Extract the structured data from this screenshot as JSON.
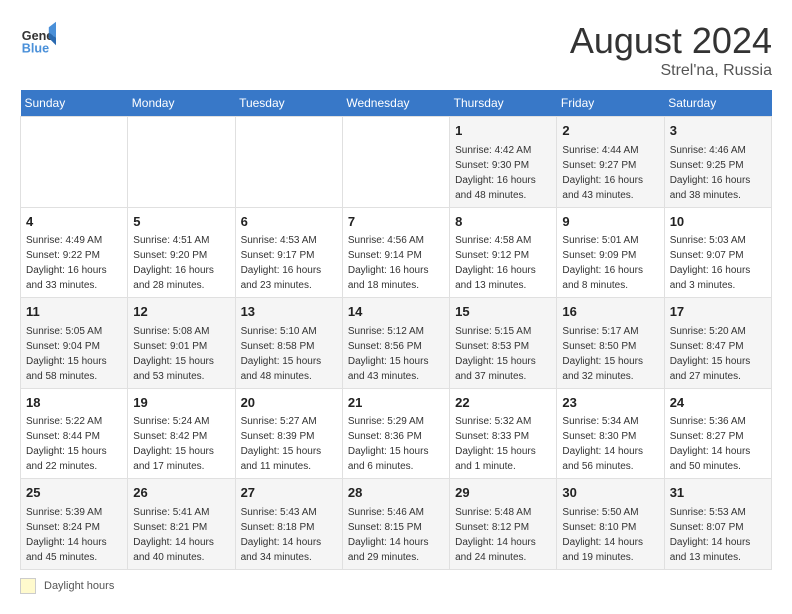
{
  "header": {
    "logo_general": "General",
    "logo_blue": "Blue",
    "month": "August 2024",
    "location": "Strel'na, Russia"
  },
  "days_of_week": [
    "Sunday",
    "Monday",
    "Tuesday",
    "Wednesday",
    "Thursday",
    "Friday",
    "Saturday"
  ],
  "legend": {
    "box_label": "Daylight hours"
  },
  "weeks": [
    [
      {
        "day": "",
        "info": ""
      },
      {
        "day": "",
        "info": ""
      },
      {
        "day": "",
        "info": ""
      },
      {
        "day": "",
        "info": ""
      },
      {
        "day": "1",
        "info": "Sunrise: 4:42 AM\nSunset: 9:30 PM\nDaylight: 16 hours\nand 48 minutes."
      },
      {
        "day": "2",
        "info": "Sunrise: 4:44 AM\nSunset: 9:27 PM\nDaylight: 16 hours\nand 43 minutes."
      },
      {
        "day": "3",
        "info": "Sunrise: 4:46 AM\nSunset: 9:25 PM\nDaylight: 16 hours\nand 38 minutes."
      }
    ],
    [
      {
        "day": "4",
        "info": "Sunrise: 4:49 AM\nSunset: 9:22 PM\nDaylight: 16 hours\nand 33 minutes."
      },
      {
        "day": "5",
        "info": "Sunrise: 4:51 AM\nSunset: 9:20 PM\nDaylight: 16 hours\nand 28 minutes."
      },
      {
        "day": "6",
        "info": "Sunrise: 4:53 AM\nSunset: 9:17 PM\nDaylight: 16 hours\nand 23 minutes."
      },
      {
        "day": "7",
        "info": "Sunrise: 4:56 AM\nSunset: 9:14 PM\nDaylight: 16 hours\nand 18 minutes."
      },
      {
        "day": "8",
        "info": "Sunrise: 4:58 AM\nSunset: 9:12 PM\nDaylight: 16 hours\nand 13 minutes."
      },
      {
        "day": "9",
        "info": "Sunrise: 5:01 AM\nSunset: 9:09 PM\nDaylight: 16 hours\nand 8 minutes."
      },
      {
        "day": "10",
        "info": "Sunrise: 5:03 AM\nSunset: 9:07 PM\nDaylight: 16 hours\nand 3 minutes."
      }
    ],
    [
      {
        "day": "11",
        "info": "Sunrise: 5:05 AM\nSunset: 9:04 PM\nDaylight: 15 hours\nand 58 minutes."
      },
      {
        "day": "12",
        "info": "Sunrise: 5:08 AM\nSunset: 9:01 PM\nDaylight: 15 hours\nand 53 minutes."
      },
      {
        "day": "13",
        "info": "Sunrise: 5:10 AM\nSunset: 8:58 PM\nDaylight: 15 hours\nand 48 minutes."
      },
      {
        "day": "14",
        "info": "Sunrise: 5:12 AM\nSunset: 8:56 PM\nDaylight: 15 hours\nand 43 minutes."
      },
      {
        "day": "15",
        "info": "Sunrise: 5:15 AM\nSunset: 8:53 PM\nDaylight: 15 hours\nand 37 minutes."
      },
      {
        "day": "16",
        "info": "Sunrise: 5:17 AM\nSunset: 8:50 PM\nDaylight: 15 hours\nand 32 minutes."
      },
      {
        "day": "17",
        "info": "Sunrise: 5:20 AM\nSunset: 8:47 PM\nDaylight: 15 hours\nand 27 minutes."
      }
    ],
    [
      {
        "day": "18",
        "info": "Sunrise: 5:22 AM\nSunset: 8:44 PM\nDaylight: 15 hours\nand 22 minutes."
      },
      {
        "day": "19",
        "info": "Sunrise: 5:24 AM\nSunset: 8:42 PM\nDaylight: 15 hours\nand 17 minutes."
      },
      {
        "day": "20",
        "info": "Sunrise: 5:27 AM\nSunset: 8:39 PM\nDaylight: 15 hours\nand 11 minutes."
      },
      {
        "day": "21",
        "info": "Sunrise: 5:29 AM\nSunset: 8:36 PM\nDaylight: 15 hours\nand 6 minutes."
      },
      {
        "day": "22",
        "info": "Sunrise: 5:32 AM\nSunset: 8:33 PM\nDaylight: 15 hours\nand 1 minute."
      },
      {
        "day": "23",
        "info": "Sunrise: 5:34 AM\nSunset: 8:30 PM\nDaylight: 14 hours\nand 56 minutes."
      },
      {
        "day": "24",
        "info": "Sunrise: 5:36 AM\nSunset: 8:27 PM\nDaylight: 14 hours\nand 50 minutes."
      }
    ],
    [
      {
        "day": "25",
        "info": "Sunrise: 5:39 AM\nSunset: 8:24 PM\nDaylight: 14 hours\nand 45 minutes."
      },
      {
        "day": "26",
        "info": "Sunrise: 5:41 AM\nSunset: 8:21 PM\nDaylight: 14 hours\nand 40 minutes."
      },
      {
        "day": "27",
        "info": "Sunrise: 5:43 AM\nSunset: 8:18 PM\nDaylight: 14 hours\nand 34 minutes."
      },
      {
        "day": "28",
        "info": "Sunrise: 5:46 AM\nSunset: 8:15 PM\nDaylight: 14 hours\nand 29 minutes."
      },
      {
        "day": "29",
        "info": "Sunrise: 5:48 AM\nSunset: 8:12 PM\nDaylight: 14 hours\nand 24 minutes."
      },
      {
        "day": "30",
        "info": "Sunrise: 5:50 AM\nSunset: 8:10 PM\nDaylight: 14 hours\nand 19 minutes."
      },
      {
        "day": "31",
        "info": "Sunrise: 5:53 AM\nSunset: 8:07 PM\nDaylight: 14 hours\nand 13 minutes."
      }
    ]
  ]
}
